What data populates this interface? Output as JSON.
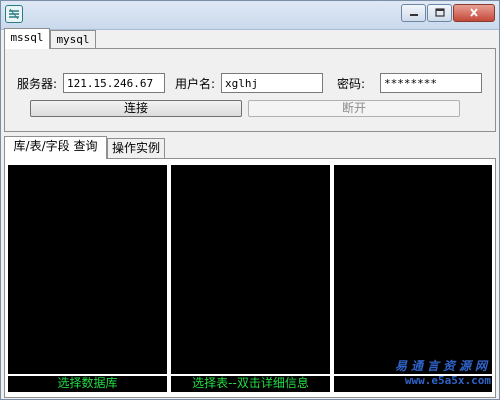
{
  "window": {
    "controls": {
      "minimize_icon": "minimize-icon",
      "maximize_icon": "maximize-icon",
      "close_icon": "close-icon"
    }
  },
  "top_tabs": [
    {
      "label": "mssql",
      "active": true
    },
    {
      "label": "mysql",
      "active": false
    }
  ],
  "connection": {
    "server_label": "服务器:",
    "server_value": "121.15.246.67",
    "user_label": "用户名:",
    "user_value": "xglhj",
    "password_label": "密码:",
    "password_value": "********",
    "connect_label": "连接",
    "disconnect_label": "断开",
    "disconnect_enabled": false
  },
  "bottom_tabs": [
    {
      "label": "库/表/字段 查询",
      "active": true
    },
    {
      "label": "操作实例",
      "active": false
    }
  ],
  "panes": [
    {
      "caption": "选择数据库"
    },
    {
      "caption": "选择表--双击详细信息"
    },
    {
      "caption": ""
    }
  ],
  "watermark": {
    "line1": "易通言资源网",
    "line2": "www.e5a5x.com"
  },
  "colors": {
    "pane_background": "#000000",
    "caption_text": "#22dd44",
    "watermark": "#2f63c8"
  }
}
